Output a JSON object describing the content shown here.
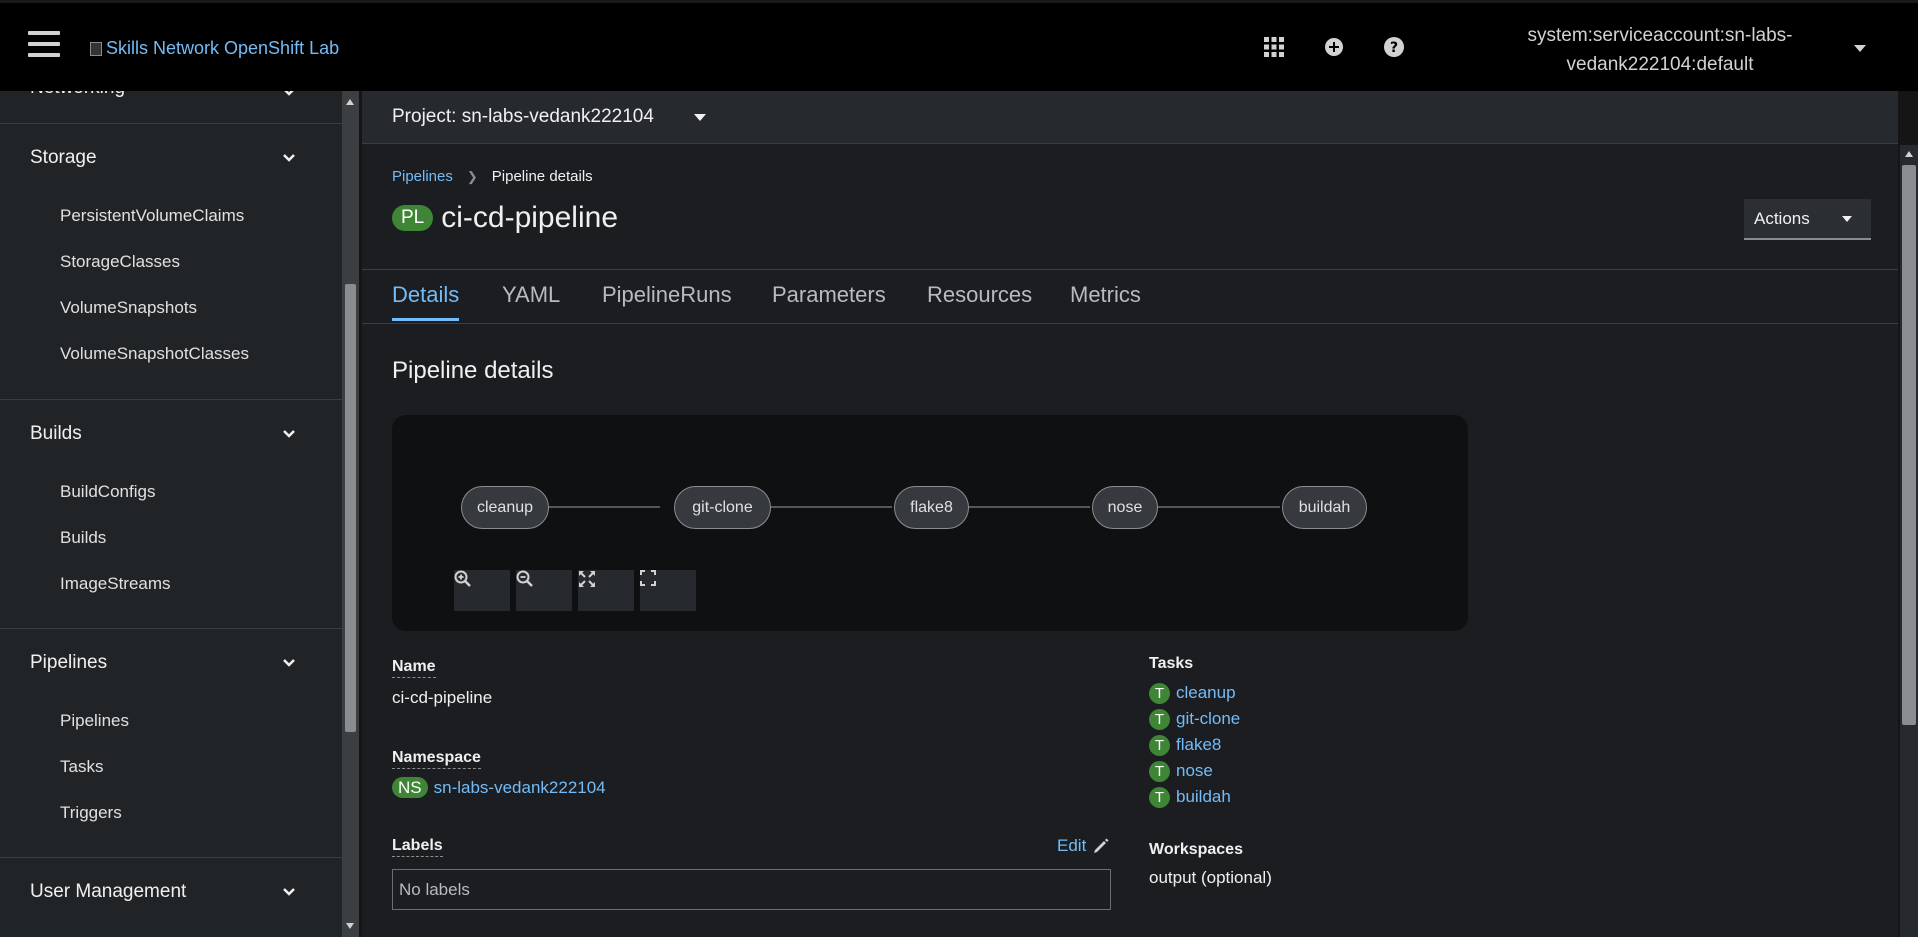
{
  "masthead": {
    "brand_alt": "Skills Network OpenShift Lab",
    "user_line1": "system:serviceaccount:sn-labs-",
    "user_line2": "vedank222104:default",
    "icons": [
      "apps-grid-icon",
      "plus-circle-icon",
      "help-icon"
    ]
  },
  "sidebar": {
    "partial_header": "Networking",
    "sections": [
      {
        "title": "Storage",
        "items": [
          "PersistentVolumeClaims",
          "StorageClasses",
          "VolumeSnapshots",
          "VolumeSnapshotClasses"
        ]
      },
      {
        "title": "Builds",
        "items": [
          "BuildConfigs",
          "Builds",
          "ImageStreams"
        ]
      },
      {
        "title": "Pipelines",
        "items": [
          "Pipelines",
          "Tasks",
          "Triggers"
        ]
      },
      {
        "title": "User Management",
        "items": []
      }
    ]
  },
  "project_bar": {
    "label": "Project: sn-labs-vedank222104"
  },
  "breadcrumb": {
    "parent": "Pipelines",
    "current": "Pipeline details"
  },
  "header": {
    "badge": "PL",
    "title": "ci-cd-pipeline",
    "actions_label": "Actions"
  },
  "tabs": [
    "Details",
    "YAML",
    "PipelineRuns",
    "Parameters",
    "Resources",
    "Metrics"
  ],
  "details": {
    "section_title": "Pipeline details",
    "graph_nodes": [
      "cleanup",
      "git-clone",
      "flake8",
      "nose",
      "buildah"
    ],
    "graph_tools": [
      "zoom-in-icon",
      "zoom-out-icon",
      "fit-to-screen-icon",
      "expand-icon"
    ],
    "name_label": "Name",
    "name_value": "ci-cd-pipeline",
    "namespace_label": "Namespace",
    "namespace_badge": "NS",
    "namespace_value": "sn-labs-vedank222104",
    "labels_label": "Labels",
    "edit_label": "Edit",
    "labels_placeholder": "No labels",
    "tasks_label": "Tasks",
    "task_badge": "T",
    "tasks": [
      "cleanup",
      "git-clone",
      "flake8",
      "nose",
      "buildah"
    ],
    "workspaces_label": "Workspaces",
    "workspaces_value": "output (optional)"
  },
  "colors": {
    "accent": "#73bcf7",
    "badge_green": "#3e8635",
    "masthead": "#000000",
    "sidebar": "#212427",
    "main_bg": "#1b1d21"
  }
}
